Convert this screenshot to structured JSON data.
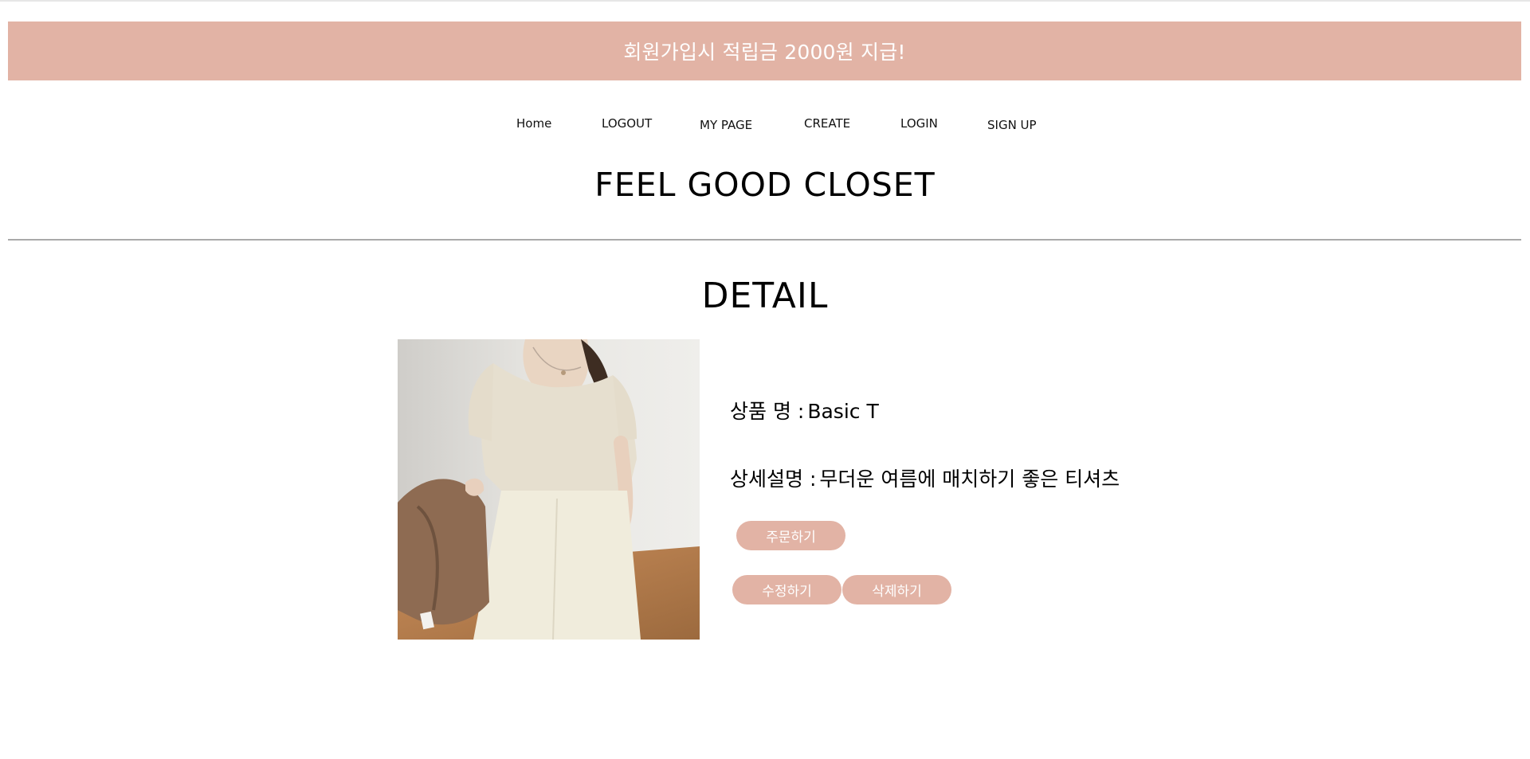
{
  "banner": {
    "text": "회원가입시 적립금 2000원 지급!"
  },
  "nav": {
    "items": [
      "Home",
      "LOGOUT",
      "MY PAGE",
      "CREATE",
      "LOGIN",
      "SIGN UP"
    ]
  },
  "brand": {
    "title": "FEEL GOOD CLOSET"
  },
  "page": {
    "title": "DETAIL"
  },
  "product": {
    "name_label": "상품 명 :",
    "name_value": "Basic T",
    "desc_label": "상세설명 :",
    "desc_value": "무더운 여름에 매치하기 좋은 티셔츠",
    "image": "product-photo"
  },
  "actions": {
    "order": "주문하기",
    "edit": "수정하기",
    "delete": "삭제하기"
  },
  "colors": {
    "accent": "#e2b3a5",
    "divider": "#a9a9a9"
  }
}
